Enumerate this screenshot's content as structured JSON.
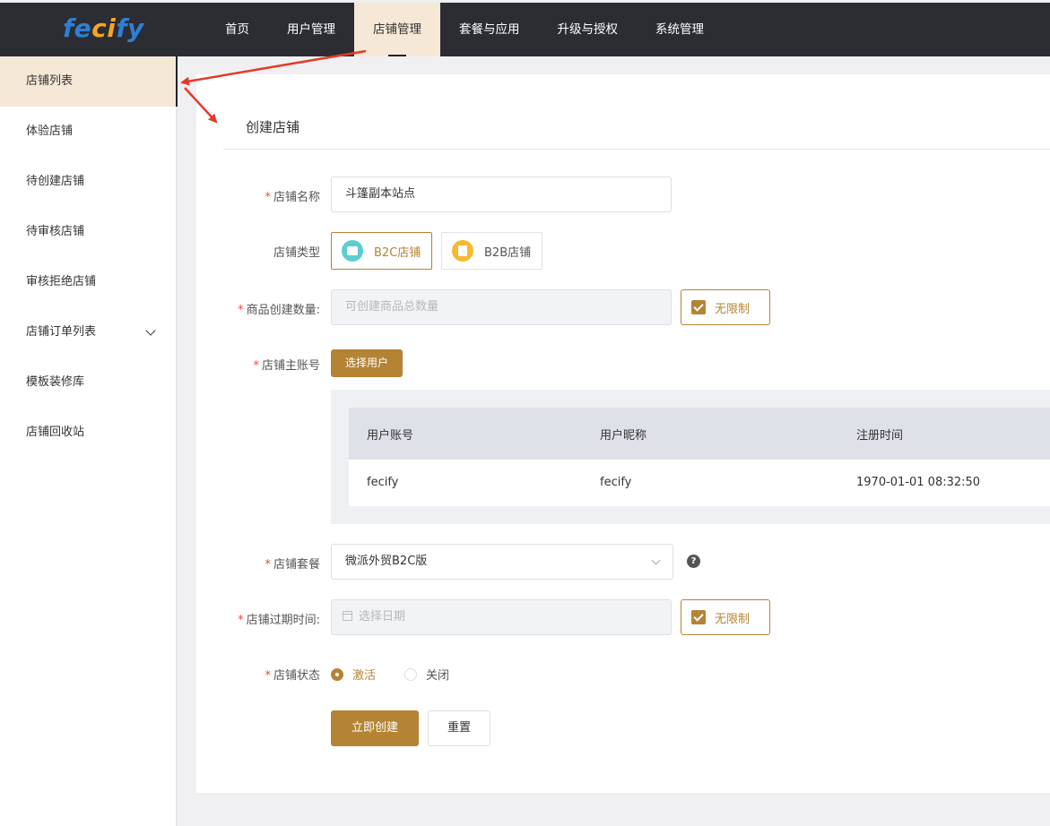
{
  "brand": {
    "logo_pre": "fe",
    "logo_mid": "ci",
    "logo_post": "fy"
  },
  "topnav": {
    "items": [
      {
        "label": "首页"
      },
      {
        "label": "用户管理"
      },
      {
        "label": "店铺管理"
      },
      {
        "label": "套餐与应用"
      },
      {
        "label": "升级与授权"
      },
      {
        "label": "系统管理"
      }
    ],
    "active_index": 2
  },
  "sidebar": {
    "items": [
      {
        "label": "店铺列表"
      },
      {
        "label": "体验店铺"
      },
      {
        "label": "待创建店铺"
      },
      {
        "label": "待审核店铺"
      },
      {
        "label": "审核拒绝店铺"
      },
      {
        "label": "店铺订单列表"
      },
      {
        "label": "模板装修库"
      },
      {
        "label": "店铺回收站"
      }
    ],
    "active_index": 0
  },
  "form": {
    "title": "创建店铺",
    "store_name": {
      "label": "店铺名称",
      "value": "斗篷副本站点"
    },
    "store_type": {
      "label": "店铺类型",
      "options": [
        "B2C店铺",
        "B2B店铺"
      ],
      "selected": "B2C店铺"
    },
    "product_count": {
      "label": "商品创建数量:",
      "placeholder": "可创建商品总数量",
      "unlimited_label": "无限制",
      "unlimited_checked": true
    },
    "owner": {
      "label": "店铺主账号",
      "select_button": "选择用户",
      "table": {
        "headers": [
          "用户账号",
          "用户昵称",
          "注册时间"
        ],
        "rows": [
          [
            "fecify",
            "fecify",
            "1970-01-01 08:32:50"
          ]
        ]
      }
    },
    "package": {
      "label": "店铺套餐",
      "value": "微派外贸B2C版",
      "help": "?"
    },
    "expire": {
      "label": "店铺过期时间:",
      "placeholder": "选择日期",
      "unlimited_label": "无限制",
      "unlimited_checked": true
    },
    "status": {
      "label": "店铺状态",
      "options": [
        "激活",
        "关闭"
      ],
      "selected": "激活"
    },
    "submit_label": "立即创建",
    "reset_label": "重置"
  },
  "colors": {
    "accent": "#b48434",
    "nav_bg": "#2b2d33",
    "active_bg": "#f5e8d6",
    "annotation": "#e8382a"
  }
}
